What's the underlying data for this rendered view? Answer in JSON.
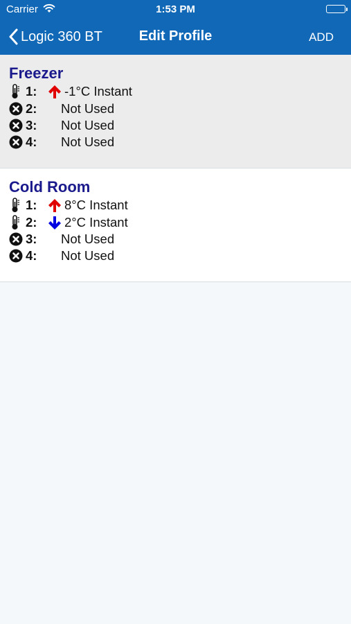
{
  "status_bar": {
    "carrier": "Carrier",
    "time": "1:53 PM",
    "wifi_icon": "wifi-icon",
    "battery_icon": "battery-icon"
  },
  "nav": {
    "back_label": "Logic 360 BT",
    "title": "Edit Profile",
    "add_label": "ADD"
  },
  "colors": {
    "bar": "#1068b7",
    "profile_name": "#1a1a8c",
    "arrow_up": "#e00000",
    "arrow_down": "#0000e0"
  },
  "profiles": [
    {
      "name": "Freezer",
      "probes": [
        {
          "num": "1:",
          "icon": "thermometer-icon",
          "direction": "up",
          "text": "-1°C Instant"
        },
        {
          "num": "2:",
          "icon": "x-circle-icon",
          "direction": "",
          "text": "Not Used"
        },
        {
          "num": "3:",
          "icon": "x-circle-icon",
          "direction": "",
          "text": "Not Used"
        },
        {
          "num": "4:",
          "icon": "x-circle-icon",
          "direction": "",
          "text": "Not Used"
        }
      ]
    },
    {
      "name": "Cold Room",
      "probes": [
        {
          "num": "1:",
          "icon": "thermometer-icon",
          "direction": "up",
          "text": "8°C Instant"
        },
        {
          "num": "2:",
          "icon": "thermometer-icon",
          "direction": "down",
          "text": "2°C Instant"
        },
        {
          "num": "3:",
          "icon": "x-circle-icon",
          "direction": "",
          "text": "Not Used"
        },
        {
          "num": "4:",
          "icon": "x-circle-icon",
          "direction": "",
          "text": "Not Used"
        }
      ]
    }
  ]
}
